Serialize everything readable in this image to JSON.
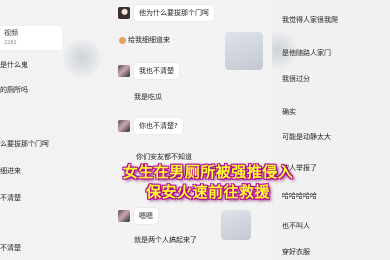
{
  "left_panel": {
    "top_text": "",
    "video_card": {
      "label": "视频",
      "sub": "2261"
    },
    "messages": [
      "是什么鬼",
      "的厕所吗",
      "么要拔那个门呵",
      "细进来",
      "不清楚",
      "不清楚"
    ]
  },
  "middle_panel": {
    "messages": [
      "他为什么要拔那个门呵",
      "给我细细道来",
      "我也不清楚",
      "我是吃瓜",
      "你也不清楚?",
      "你们安友都不知道",
      "嗯嗯",
      "就是两个人搞起来了"
    ],
    "emoji_label": "🌝"
  },
  "right_panel": {
    "messages": [
      "我觉得人家很我爬",
      "是他随路人家门",
      "我很过分",
      "确实",
      "可能是动静太大",
      "被人举报了",
      "哈哈哈哈哈",
      "也不叫人",
      "穿好衣服"
    ]
  },
  "caption": {
    "line1": "女生在男厕所被强推侵入",
    "line2": "保安火速前往救援"
  },
  "colors": {
    "caption_fill": "#ffff2e",
    "caption_stroke": "#b0008f",
    "bubble": "#ffffff"
  }
}
